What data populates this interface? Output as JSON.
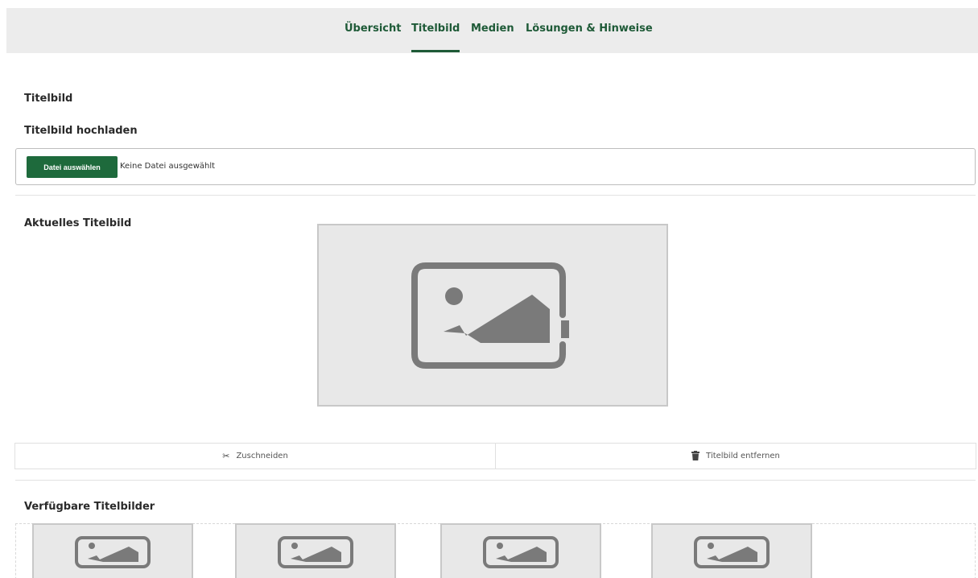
{
  "nav": {
    "tabs": [
      {
        "label": "Übersicht",
        "active": false
      },
      {
        "label": "Titelbild",
        "active": true
      },
      {
        "label": "Medien",
        "active": false
      },
      {
        "label": "Lösungen & Hinweise",
        "active": false
      }
    ]
  },
  "section": {
    "title": "Titelbild",
    "upload_heading": "Titelbild hochladen",
    "file_button": "Datei auswählen",
    "file_status": "Keine Datei ausgewählt",
    "current_heading": "Aktuelles Titelbild",
    "crop_label": "Zuschneiden",
    "remove_label": "Titelbild entfernen",
    "available_heading": "Verfügbare Titelbilder"
  },
  "icons": {
    "placeholder": "image-placeholder-icon",
    "crop": "scissors-icon",
    "remove": "trash-icon"
  },
  "colors": {
    "accent": "#1e6a3c",
    "nav_text": "#1e5a37",
    "topbar_bg": "#ececec",
    "placeholder_bg": "#e8e8e8",
    "placeholder_icon": "#7a7a7a"
  }
}
